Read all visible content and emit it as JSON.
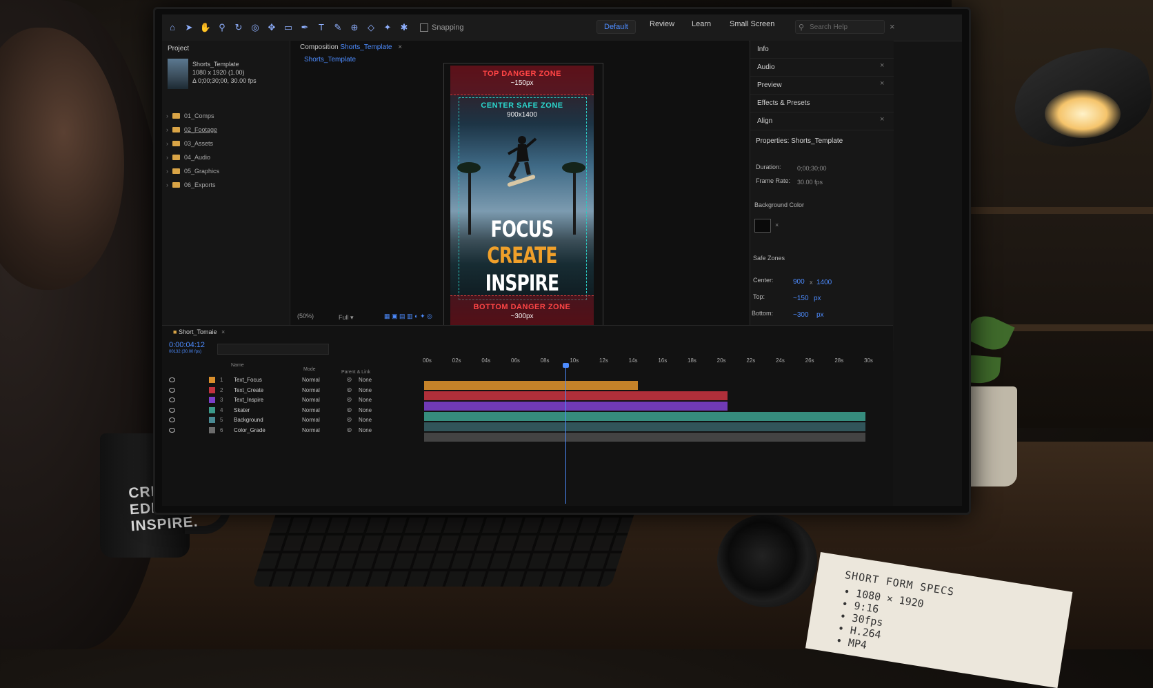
{
  "toolbar": {
    "snapping_label": "Snapping",
    "workspaces": [
      "Default",
      "Review",
      "Learn",
      "Small Screen"
    ],
    "search_placeholder": "Search Help"
  },
  "project": {
    "tab_label": "Project",
    "item_name": "Shorts_Template",
    "item_dims": "1080 x 1920 (1.00)",
    "item_duration": "Δ 0;00;30;00, 30.00 fps",
    "folders": [
      "01_Comps",
      "02_Footage",
      "03_Assets",
      "04_Audio",
      "05_Graphics",
      "06_Exports"
    ]
  },
  "composition": {
    "tab_prefix": "Composition",
    "tab_name": "Shorts_Template",
    "sub_tab": "Shorts_Template",
    "zoom": "(50%)",
    "resolution": "Full",
    "top_zone_label": "TOP DANGER ZONE",
    "top_zone_value": "~150px",
    "center_zone_label": "CENTER SAFE ZONE",
    "center_zone_value": "900x1400",
    "bottom_zone_label": "BOTTOM DANGER ZONE",
    "bottom_zone_value": "~300px",
    "headline_1": "FOCUS",
    "headline_2": "CREATE",
    "headline_3": "INSPIRE"
  },
  "right_panel": {
    "info": "Info",
    "audio": "Audio",
    "preview": "Preview",
    "effects": "Effects & Presets",
    "align": "Align",
    "properties_title": "Properties: Shorts_Template",
    "duration_label": "Duration:",
    "duration_value": "0;00;30;00",
    "framerate_label": "Frame Rate:",
    "framerate_value": "30.00",
    "framerate_unit": "fps",
    "bgcolor_label": "Background Color",
    "safe_zones_label": "Safe Zones",
    "center_label": "Center:",
    "center_w": "900",
    "center_x": "x",
    "center_h": "1400",
    "top_label": "Top:",
    "top_value": "~150",
    "top_unit": "px",
    "bottom_label": "Bottom:",
    "bottom_value": "~300",
    "bottom_unit": "px"
  },
  "timeline": {
    "tab_label": "Short_Tomaie",
    "timecode": "0:00:04:12",
    "timecode_sub": "00132 (30.00 fps)",
    "col_name": "Name",
    "col_mode": "Mode",
    "col_parent": "Parent & Link",
    "layers": [
      {
        "num": "1",
        "name": "Text_Focus",
        "mode": "Normal",
        "parent": "None",
        "color": "#d98f2c"
      },
      {
        "num": "2",
        "name": "Text_Create",
        "mode": "Normal",
        "parent": "None",
        "color": "#c2333f"
      },
      {
        "num": "3",
        "name": "Text_Inspire",
        "mode": "Normal",
        "parent": "None",
        "color": "#7b3fc9"
      },
      {
        "num": "4",
        "name": "Skater",
        "mode": "Normal",
        "parent": "None",
        "color": "#3b9a8a"
      },
      {
        "num": "5",
        "name": "Background",
        "mode": "Normal",
        "parent": "None",
        "color": "#4a8a93"
      },
      {
        "num": "6",
        "name": "Color_Grade",
        "mode": "Normal",
        "parent": "None",
        "color": "#6c6c6c"
      }
    ],
    "ruler": [
      "00s",
      "02s",
      "04s",
      "06s",
      "08s",
      "10s",
      "12s",
      "14s",
      "16s",
      "18s",
      "20s",
      "22s",
      "24s",
      "26s",
      "28s",
      "30s"
    ]
  },
  "desk": {
    "mug_text": [
      "CREATE.",
      "EDIT.",
      "INSPIRE."
    ],
    "notebook_title": "SHORT FORM SPECS",
    "notebook_items": [
      "• 1080 × 1920",
      "• 9:16",
      "• 30fps",
      "• H.264",
      "• MP4"
    ]
  }
}
